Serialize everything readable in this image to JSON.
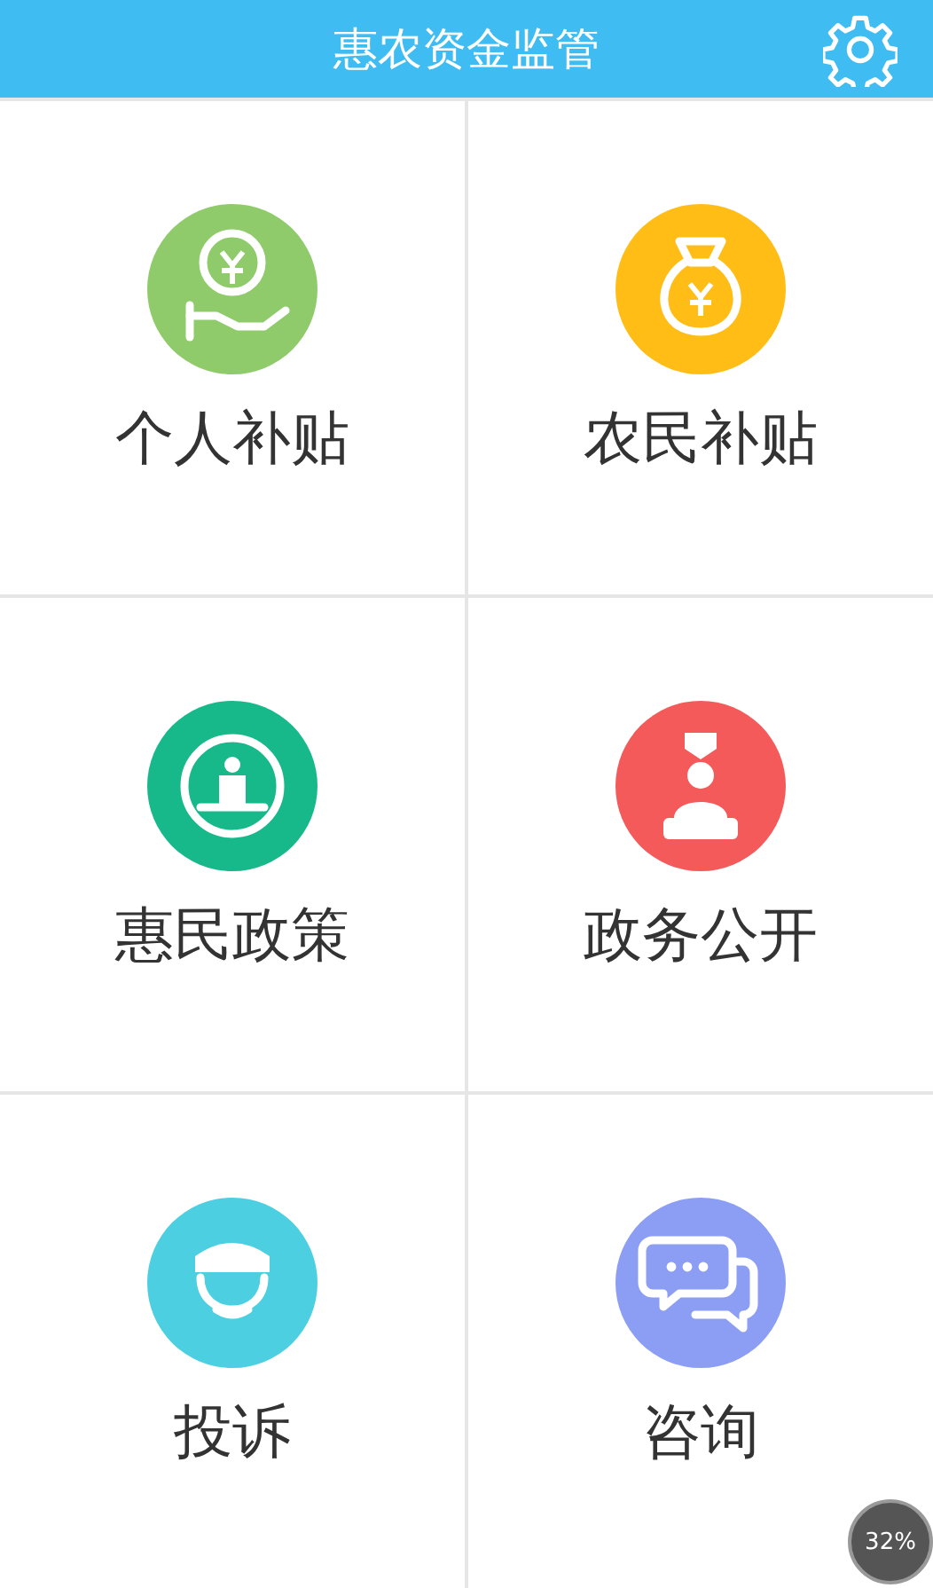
{
  "header": {
    "title": "惠农资金监管"
  },
  "tiles": [
    {
      "label": "个人补贴",
      "color": "#8fcb6b"
    },
    {
      "label": "农民补贴",
      "color": "#ffbd16"
    },
    {
      "label": "惠民政策",
      "color": "#17b98a"
    },
    {
      "label": "政务公开",
      "color": "#f45a5a"
    },
    {
      "label": "投诉",
      "color": "#4ccfe0"
    },
    {
      "label": "咨询",
      "color": "#8b9ef4"
    }
  ],
  "float_badge": {
    "text": "32%"
  }
}
